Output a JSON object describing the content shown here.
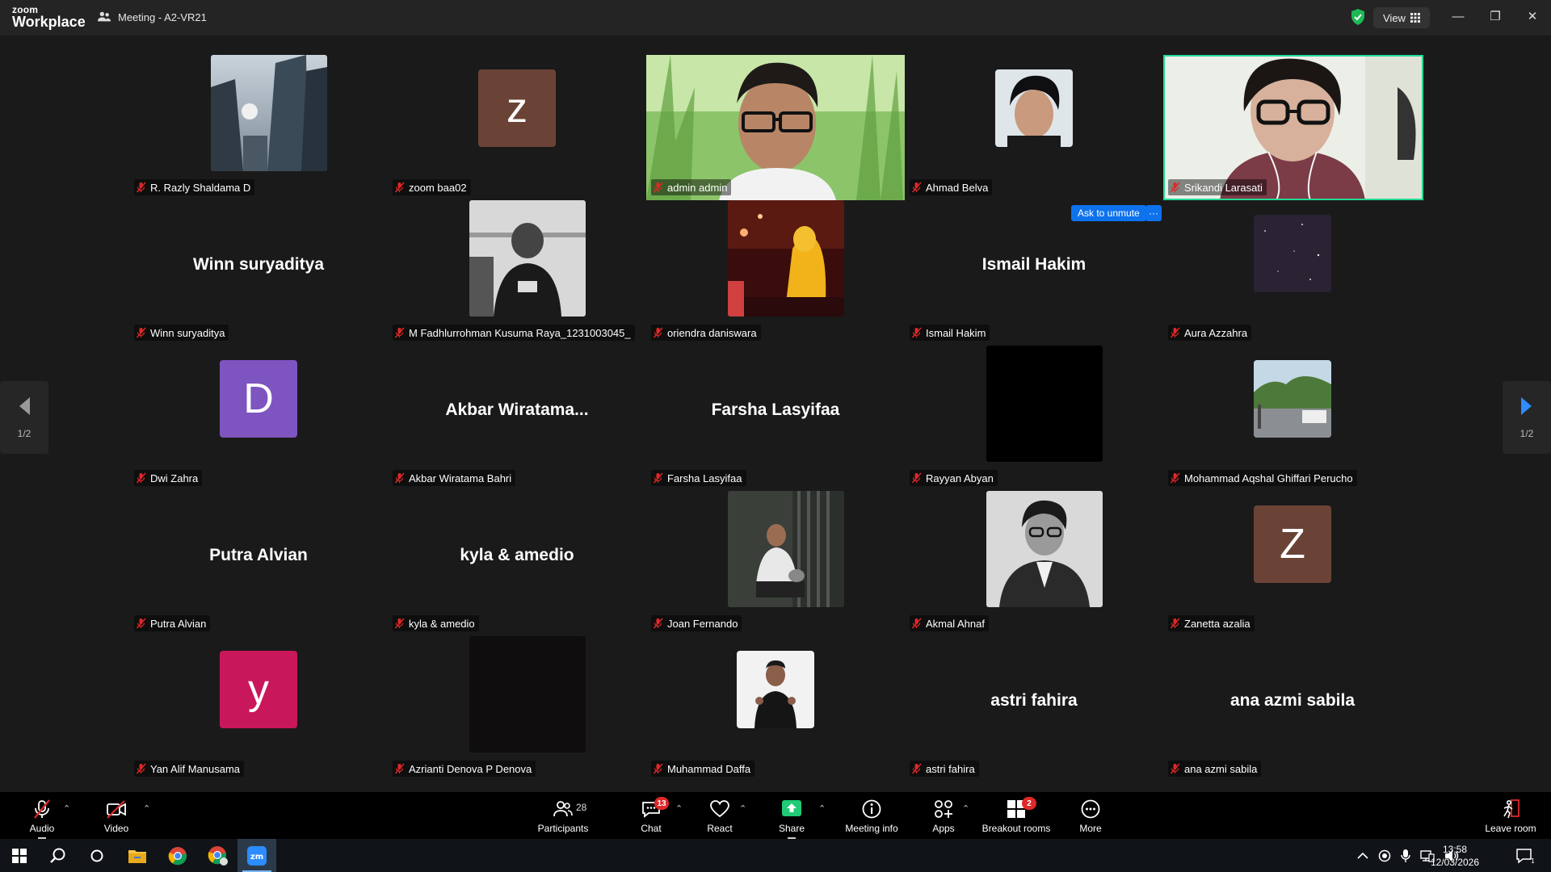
{
  "app": {
    "logo_small": "zoom",
    "logo_big": "Workplace",
    "meeting_title": "Meeting - A2-VR21",
    "view_label": "View"
  },
  "pager": {
    "page_left": "1/2",
    "page_right": "1/2"
  },
  "participants": [
    {
      "name": "R. Razly Shaldama D",
      "kind": "photo",
      "photo": "buildings"
    },
    {
      "name": "zoom baa02",
      "kind": "letter",
      "letter": "z",
      "color": "#6b4336"
    },
    {
      "name": "admin admin",
      "kind": "video",
      "photo": "man-grass"
    },
    {
      "name": "Ahmad Belva",
      "kind": "photo-sm",
      "photo": "man-dark"
    },
    {
      "name": "Srikandi Larasati",
      "kind": "video",
      "photo": "girl-glasses",
      "active": true
    },
    {
      "name": "Winn suryaditya",
      "kind": "text",
      "display": "Winn suryaditya"
    },
    {
      "name": "M Fadhlurrohman Kusuma Raya_1231003045_",
      "kind": "photo",
      "photo": "bw-man"
    },
    {
      "name": "oriendra daniswara",
      "kind": "photo",
      "photo": "yellow-figure"
    },
    {
      "name": "Ismail Hakim",
      "kind": "text",
      "display": "Ismail Hakim"
    },
    {
      "name": "Aura Azzahra",
      "kind": "photo-sm",
      "photo": "space"
    },
    {
      "name": "Dwi Zahra",
      "kind": "letter",
      "letter": "D",
      "color": "#7d54c0"
    },
    {
      "name": "Akbar Wiratama Bahri",
      "kind": "text",
      "display": "Akbar  Wiratama..."
    },
    {
      "name": "Farsha Lasyifaa",
      "kind": "text",
      "display": "Farsha Lasyifaa"
    },
    {
      "name": "Rayyan Abyan",
      "kind": "photo",
      "photo": "black"
    },
    {
      "name": "Mohammad Aqshal Ghiffari Perucho",
      "kind": "photo-sm",
      "photo": "street"
    },
    {
      "name": "Putra Alvian",
      "kind": "text",
      "display": "Putra Alvian"
    },
    {
      "name": "kyla & amedio",
      "kind": "text",
      "display": "kyla & amedio"
    },
    {
      "name": "Joan Fernando",
      "kind": "photo",
      "photo": "man-sitting"
    },
    {
      "name": "Akmal Ahnaf",
      "kind": "photo",
      "photo": "bw-portrait"
    },
    {
      "name": "Zanetta azalia",
      "kind": "letter",
      "letter": "Z",
      "color": "#6b4336"
    },
    {
      "name": "Yan Alif Manusama",
      "kind": "letter",
      "letter": "y",
      "color": "#c9175b"
    },
    {
      "name": "Azrianti Denova P Denova",
      "kind": "photo",
      "photo": "dark"
    },
    {
      "name": "Muhammad Daffa",
      "kind": "photo-sm",
      "photo": "man-thumbs"
    },
    {
      "name": "astri fahira",
      "kind": "text",
      "display": "astri fahira"
    },
    {
      "name": "ana azmi sabila",
      "kind": "text",
      "display": "ana azmi sabila"
    }
  ],
  "unmute": {
    "label": "Ask to unmute",
    "more": "···"
  },
  "toolbar": {
    "audio": "Audio",
    "video": "Video",
    "participants": "Participants",
    "participants_count": "28",
    "chat": "Chat",
    "chat_badge": "13",
    "react": "React",
    "share": "Share",
    "meeting_info": "Meeting info",
    "apps": "Apps",
    "breakout": "Breakout rooms",
    "breakout_badge": "2",
    "more": "More",
    "leave": "Leave room"
  },
  "taskbar": {
    "time": "13:58",
    "date": "12/03/2026",
    "notification_count": "1"
  },
  "colors": {
    "accent_blue": "#0e72ed",
    "active_speaker": "#23d996",
    "muted_red": "#e02828",
    "share_green": "#1fcb74"
  }
}
